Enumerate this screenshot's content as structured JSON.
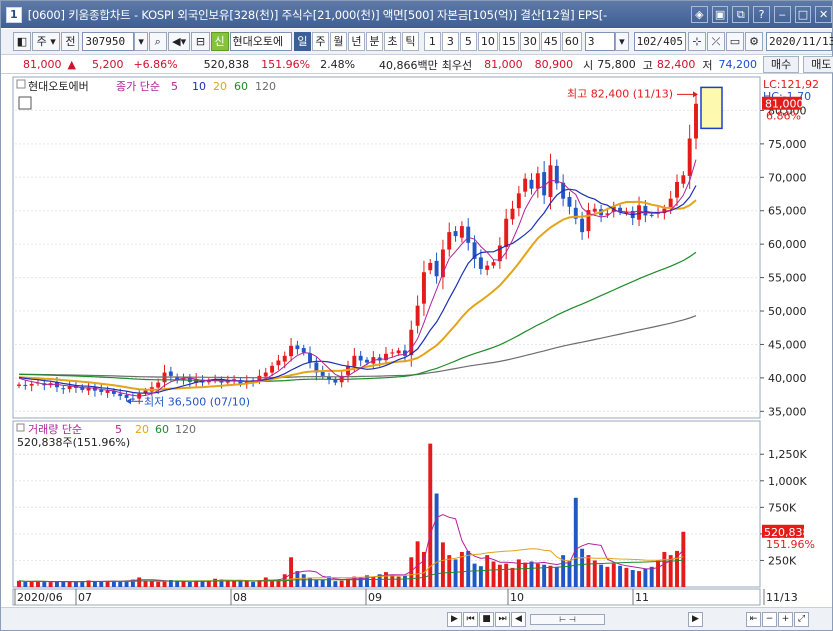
{
  "window": {
    "app_number": "1",
    "title": "[0600] 키움종합차트 - KOSPI 외국인보유[328(천)] 주식수[21,000(천)] 액면[500] 자본금[105(억)] 결산[12월] EPS[-"
  },
  "toolbar": {
    "period_label": "주",
    "prev_label": "전",
    "stock_code": "307950",
    "sin_badge": "신",
    "stock_name": "현대오토에",
    "intervals": [
      "일",
      "주",
      "월",
      "년",
      "분",
      "초",
      "틱"
    ],
    "active_interval": "일",
    "numbers": [
      "1",
      "3",
      "5",
      "10",
      "15",
      "30",
      "45",
      "60"
    ],
    "count_value": "3",
    "page_counter": "102/405",
    "date_value": "2020/11/13"
  },
  "quote": {
    "price": "81,000",
    "arrow": "▲",
    "change": "5,200",
    "change_pct": "+6.86%",
    "volume": "520,838",
    "volume_pct": "151.96%",
    "turnover": "2.48%",
    "amount": "40,866백만",
    "best_ask_label": "최우선",
    "best_ask": "81,000",
    "best_bid": "80,900",
    "open_label": "시",
    "open": "75,800",
    "high_label": "고",
    "high": "82,400",
    "low_label": "저",
    "low": "74,200",
    "buy_label": "매수",
    "sell_label": "매도"
  },
  "chart_data": [
    {
      "type": "candlestick",
      "title": "현대오토에버",
      "legend": {
        "label": "종가 단순",
        "periods": [
          "5",
          "10",
          "20",
          "60",
          "120"
        ]
      },
      "y_ticks": [
        "80,000",
        "75,000",
        "70,000",
        "65,000",
        "60,000",
        "55,000",
        "50,000",
        "45,000",
        "40,000",
        "35,000"
      ],
      "y_range": [
        34000,
        85000
      ],
      "x_ticks": [
        "2020/06",
        "07",
        "08",
        "09",
        "10",
        "11",
        "11/13"
      ],
      "annotations": {
        "high": "최고 82,400 (11/13)",
        "low": "최저 36,500 (07/10)",
        "lc": "LC:121,92",
        "hc": "HC:-1.70",
        "last_price": "81,000",
        "last_pct": "6.86%"
      },
      "closes": [
        39000,
        38800,
        39100,
        39300,
        38900,
        39200,
        38600,
        38400,
        38800,
        38500,
        38200,
        38600,
        38100,
        37900,
        38100,
        37600,
        37300,
        37000,
        36900,
        37600,
        38100,
        38600,
        39300,
        40800,
        40300,
        39600,
        39900,
        39400,
        39800,
        39300,
        39600,
        39800,
        39300,
        39500,
        39800,
        39100,
        39600,
        39500,
        40300,
        40800,
        41800,
        42600,
        43300,
        44800,
        44300,
        43800,
        42300,
        40800,
        40300,
        39800,
        39300,
        40300,
        41800,
        43300,
        42600,
        42300,
        43100,
        42600,
        43600,
        43800,
        44100,
        43300,
        47200,
        50800,
        55800,
        57200,
        55200,
        59200,
        61800,
        61200,
        62700,
        60200,
        57800,
        56300,
        56800,
        57300,
        59800,
        63800,
        65300,
        67600,
        69800,
        68300,
        70600,
        67300,
        71800,
        69100,
        66800,
        65600,
        63800,
        61800,
        65100,
        65300,
        64300,
        64600,
        65600,
        64800,
        64800,
        63900,
        65800,
        64300,
        64300,
        64800,
        65300,
        66800,
        69300,
        70300,
        75800,
        81000
      ],
      "ma_periods_plotted": [
        5,
        10,
        20,
        60,
        120
      ],
      "volume": {
        "legend": {
          "label": "거래량 단순",
          "periods": [
            "5",
            "20",
            "60",
            "120"
          ]
        },
        "current": "520,838주(151.96%)",
        "last_label": "520,838",
        "last_pct": "151.96%",
        "y_ticks": [
          "1,250K",
          "1,000K",
          "750K",
          "500K",
          "250K"
        ],
        "values": [
          58,
          48,
          52,
          55,
          50,
          46,
          53,
          49,
          51,
          47,
          55,
          62,
          48,
          52,
          58,
          60,
          55,
          62,
          70,
          90,
          60,
          55,
          48,
          50,
          66,
          58,
          52,
          48,
          56,
          60,
          52,
          78,
          70,
          60,
          52,
          58,
          62,
          48,
          66,
          90,
          60,
          72,
          120,
          280,
          150,
          120,
          90,
          68,
          70,
          100,
          55,
          60,
          78,
          98,
          92,
          110,
          96,
          120,
          140,
          115,
          98,
          105,
          280,
          430,
          330,
          1350,
          880,
          420,
          300,
          260,
          330,
          340,
          220,
          196,
          300,
          240,
          210,
          220,
          180,
          260,
          230,
          240,
          220,
          210,
          200,
          190,
          300,
          250,
          840,
          360,
          300,
          250,
          210,
          190,
          220,
          200,
          180,
          160,
          150,
          170,
          190,
          250,
          330,
          300,
          340,
          520
        ],
        "volume_up": []
      }
    }
  ],
  "colors": {
    "up": "#e51a1a",
    "down": "#1f57c5",
    "ma5": "#b1239a",
    "ma10": "#1b2fb5",
    "ma20": "#e3a417",
    "ma60": "#1c8c2a",
    "ma120": "#6d6d6d"
  }
}
